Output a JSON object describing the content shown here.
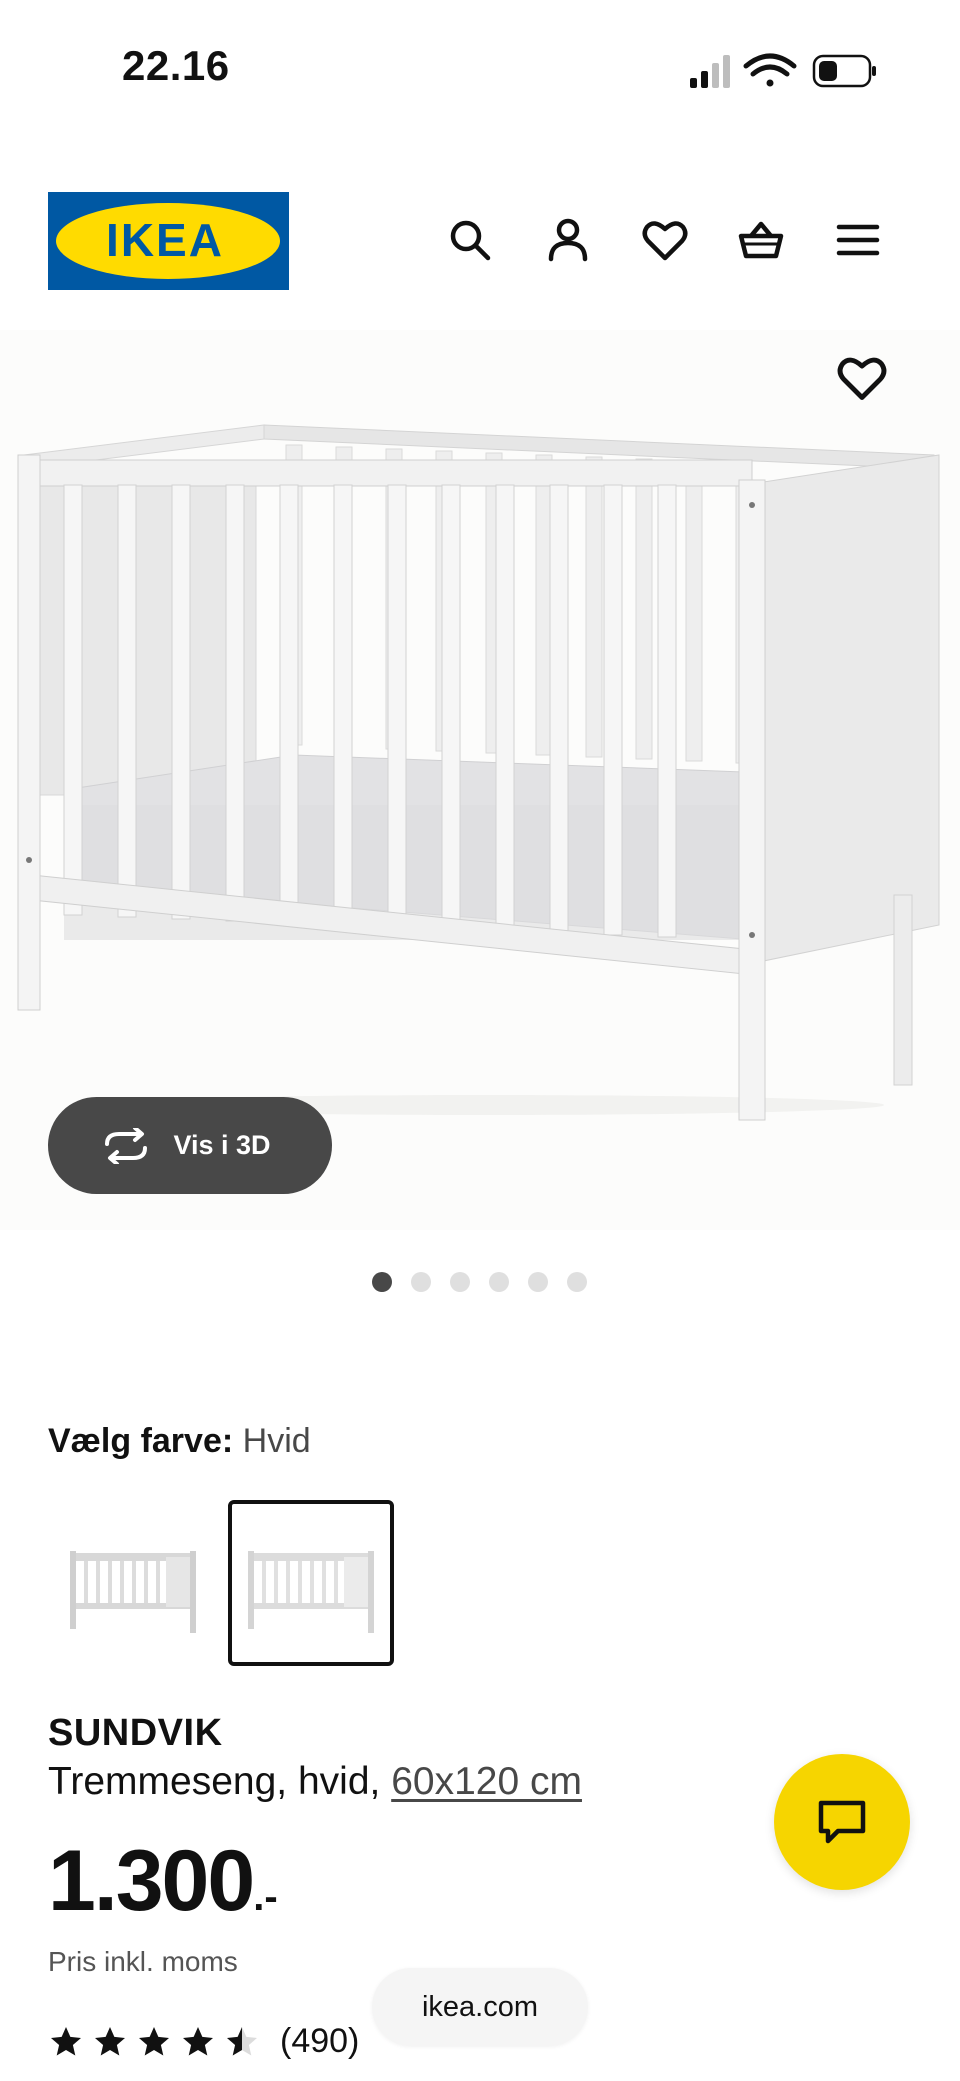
{
  "status_bar": {
    "time": "22.16",
    "signal_icon": "signal-icon",
    "wifi_icon": "wifi-icon",
    "battery_icon": "battery-icon"
  },
  "header": {
    "logo_text": "IKEA",
    "icons": [
      "search-icon",
      "account-icon",
      "favourites-icon",
      "basket-icon",
      "menu-icon"
    ],
    "brand_colors": {
      "blue": "#0058a3",
      "yellow": "#ffdb00"
    }
  },
  "gallery": {
    "favourite_icon": "heart-outline-icon",
    "view_3d_label": "Vis i 3D",
    "view_3d_icon": "rotate-icon",
    "image_count": 6,
    "active_image": 1
  },
  "color_picker": {
    "label": "Vælg farve:",
    "selected": "Hvid",
    "options": [
      {
        "name": "crib-variant-1",
        "selected": false
      },
      {
        "name": "crib-variant-2",
        "selected": true
      }
    ]
  },
  "product": {
    "name": "SUNDVIK",
    "description_prefix": "Tremmeseng, hvid,",
    "size": "60x120 cm",
    "price": "1.300",
    "price_suffix": ".-",
    "vat_note": "Pris inkl. moms",
    "rating": 4.5,
    "rating_max": 5,
    "review_count": "(490)"
  },
  "chat": {
    "icon": "chat-icon",
    "color": "#f6d500"
  },
  "browser": {
    "url": "ikea.com"
  }
}
